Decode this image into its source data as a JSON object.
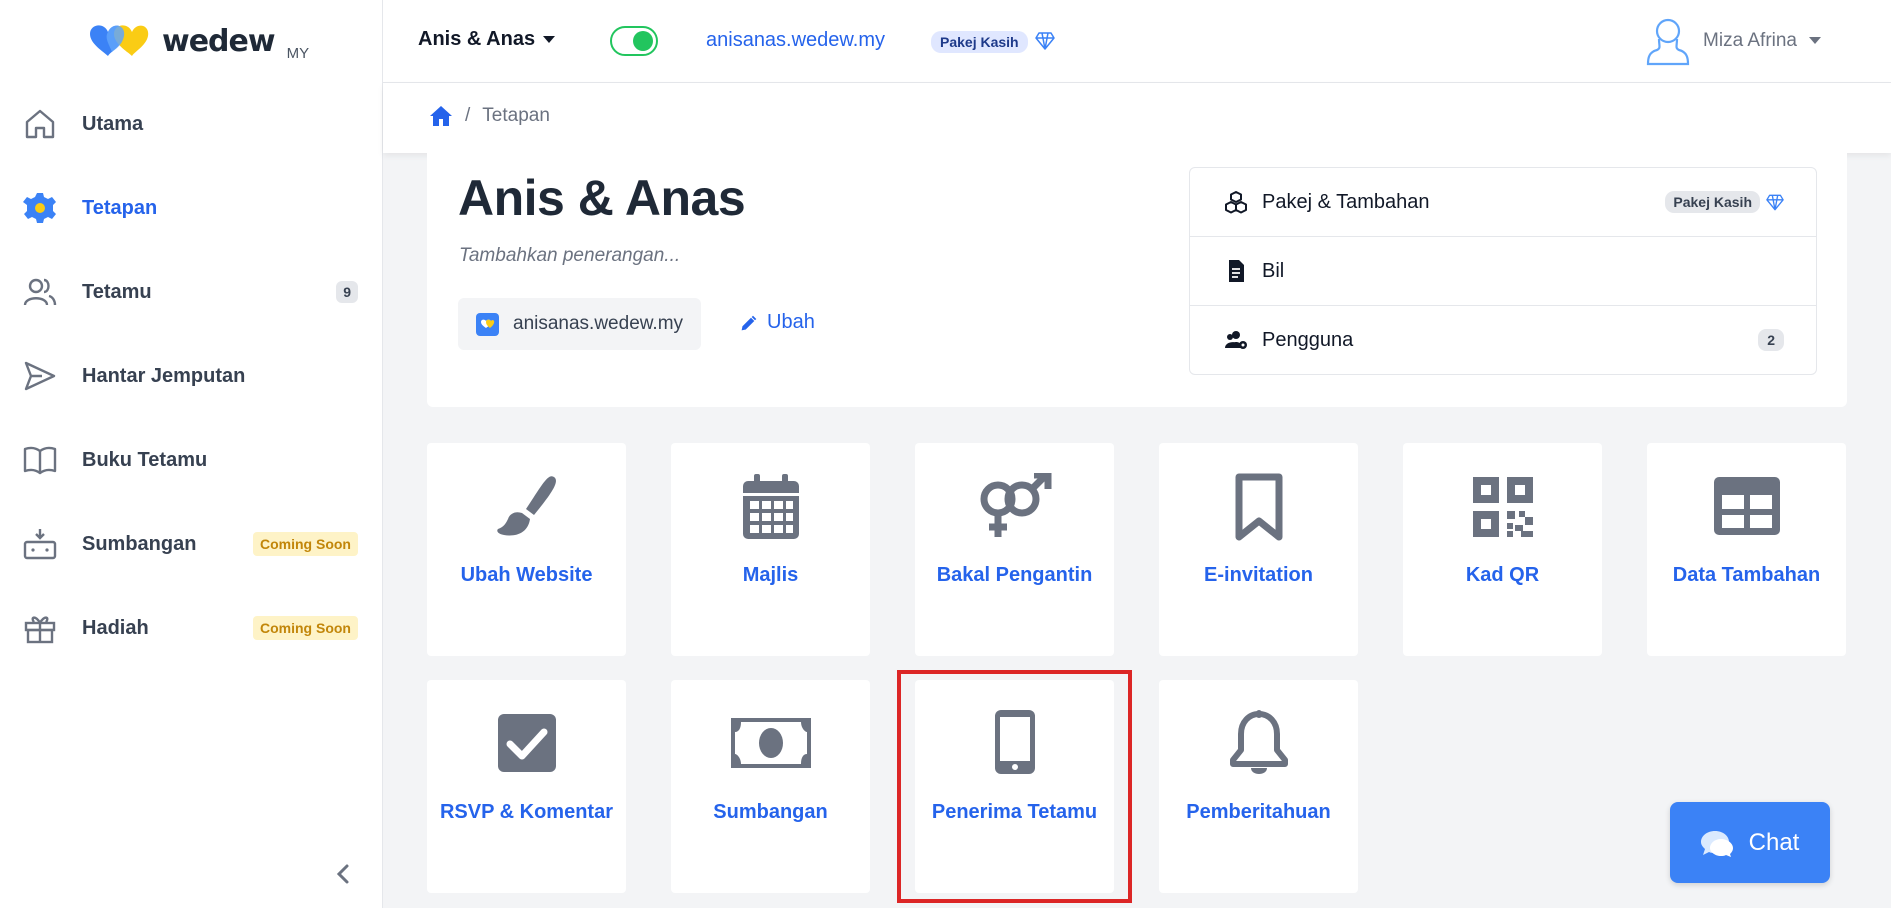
{
  "brand": {
    "name": "wedew",
    "suffix": "MY"
  },
  "sidebar": {
    "items": [
      {
        "label": "Utama",
        "icon": "home-icon"
      },
      {
        "label": "Tetapan",
        "icon": "gear-icon",
        "active": true
      },
      {
        "label": "Tetamu",
        "icon": "users-icon",
        "badge": "9"
      },
      {
        "label": "Hantar Jemputan",
        "icon": "send-icon"
      },
      {
        "label": "Buku Tetamu",
        "icon": "book-icon"
      },
      {
        "label": "Sumbangan",
        "icon": "donation-box-icon",
        "badge": "Coming Soon"
      },
      {
        "label": "Hadiah",
        "icon": "gift-icon",
        "badge": "Coming Soon"
      }
    ]
  },
  "topbar": {
    "event_name": "Anis & Anas",
    "site_toggle_on": true,
    "site_url": "anisanas.wedew.my",
    "package_badge": "Pakej Kasih",
    "user_name": "Miza Afrina"
  },
  "breadcrumb": {
    "current": "Tetapan"
  },
  "header": {
    "title": "Anis & Anas",
    "description_placeholder": "Tambahkan penerangan...",
    "domain": "anisanas.wedew.my",
    "edit_label": "Ubah"
  },
  "settings_list": [
    {
      "label": "Pakej & Tambahan",
      "icon": "cubes-icon",
      "badge": "Pakej Kasih"
    },
    {
      "label": "Bil",
      "icon": "invoice-icon"
    },
    {
      "label": "Pengguna",
      "icon": "users-cog-icon",
      "count": "2"
    }
  ],
  "tiles": [
    {
      "label": "Ubah Website",
      "icon": "paint-brush-icon"
    },
    {
      "label": "Majlis",
      "icon": "calendar-icon"
    },
    {
      "label": "Bakal Pengantin",
      "icon": "venus-mars-icon"
    },
    {
      "label": "E-invitation",
      "icon": "bookmark-icon"
    },
    {
      "label": "Kad QR",
      "icon": "qrcode-icon"
    },
    {
      "label": "Data Tambahan",
      "icon": "table-icon"
    },
    {
      "label": "RSVP & Komentar",
      "icon": "check-square-icon"
    },
    {
      "label": "Sumbangan",
      "icon": "money-bill-icon"
    },
    {
      "label": "Penerima Tetamu",
      "icon": "mobile-icon",
      "highlighted": true
    },
    {
      "label": "Pemberitahuan",
      "icon": "bell-icon"
    }
  ],
  "chat": {
    "label": "Chat"
  },
  "colors": {
    "accent": "#2563eb",
    "toggle": "#22c55e",
    "highlight": "#dc2626",
    "soon": "#c2860a"
  }
}
